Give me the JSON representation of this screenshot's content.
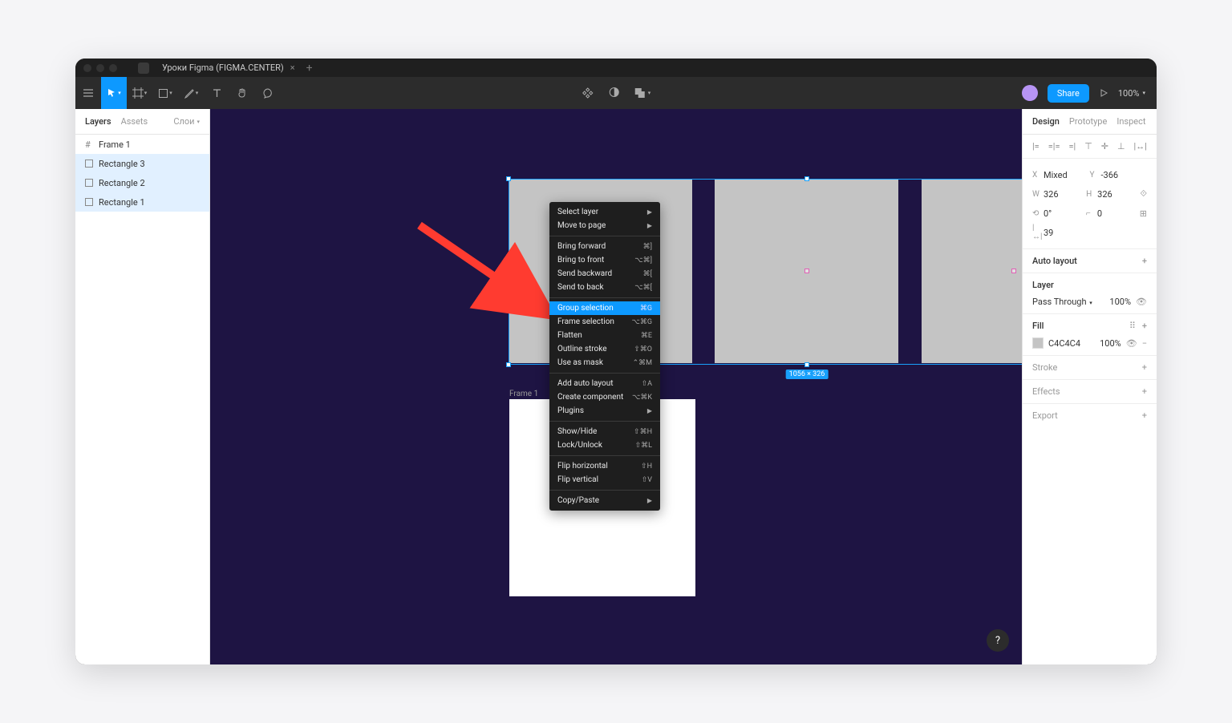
{
  "window": {
    "tab_title": "Уроки Figma (FIGMA.CENTER)"
  },
  "toolbar": {
    "share_label": "Share",
    "zoom_label": "100%"
  },
  "left_panel": {
    "tabs": {
      "layers": "Layers",
      "assets": "Assets",
      "pages_label": "Слои"
    },
    "layers": [
      {
        "name": "Frame 1",
        "selected": false,
        "type": "frame"
      },
      {
        "name": "Rectangle 3",
        "selected": true,
        "type": "rect"
      },
      {
        "name": "Rectangle 2",
        "selected": true,
        "type": "rect"
      },
      {
        "name": "Rectangle 1",
        "selected": true,
        "type": "rect"
      }
    ]
  },
  "canvas": {
    "dim_badge": "1056 × 326",
    "frame1_label": "Frame 1"
  },
  "context_menu": {
    "groups": [
      [
        {
          "label": "Select layer",
          "shortcut": "",
          "submenu": true
        },
        {
          "label": "Move to page",
          "shortcut": "",
          "submenu": true
        }
      ],
      [
        {
          "label": "Bring forward",
          "shortcut": "⌘]"
        },
        {
          "label": "Bring to front",
          "shortcut": "⌥⌘]"
        },
        {
          "label": "Send backward",
          "shortcut": "⌘["
        },
        {
          "label": "Send to back",
          "shortcut": "⌥⌘["
        }
      ],
      [
        {
          "label": "Group selection",
          "shortcut": "⌘G",
          "highlight": true
        },
        {
          "label": "Frame selection",
          "shortcut": "⌥⌘G"
        },
        {
          "label": "Flatten",
          "shortcut": "⌘E"
        },
        {
          "label": "Outline stroke",
          "shortcut": "⇧⌘O"
        },
        {
          "label": "Use as mask",
          "shortcut": "⌃⌘M"
        }
      ],
      [
        {
          "label": "Add auto layout",
          "shortcut": "⇧A"
        },
        {
          "label": "Create component",
          "shortcut": "⌥⌘K"
        },
        {
          "label": "Plugins",
          "shortcut": "",
          "submenu": true
        }
      ],
      [
        {
          "label": "Show/Hide",
          "shortcut": "⇧⌘H"
        },
        {
          "label": "Lock/Unlock",
          "shortcut": "⇧⌘L"
        }
      ],
      [
        {
          "label": "Flip horizontal",
          "shortcut": "⇧H"
        },
        {
          "label": "Flip vertical",
          "shortcut": "⇧V"
        }
      ],
      [
        {
          "label": "Copy/Paste",
          "shortcut": "",
          "submenu": true
        }
      ]
    ]
  },
  "right_panel": {
    "tabs": {
      "design": "Design",
      "prototype": "Prototype",
      "inspect": "Inspect"
    },
    "geom": {
      "x_label": "X",
      "x_value": "Mixed",
      "y_label": "Y",
      "y_value": "-366",
      "w_label": "W",
      "w_value": "326",
      "h_label": "H",
      "h_value": "326",
      "rot_label": "⟲",
      "rot_value": "0°",
      "radius_label": "⌐",
      "radius_value": "0",
      "gap_label": "|⟷|",
      "gap_value": "39"
    },
    "auto_layout": {
      "title": "Auto layout"
    },
    "layer": {
      "title": "Layer",
      "blend": "Pass Through",
      "opacity": "100%"
    },
    "fill": {
      "title": "Fill",
      "hex": "C4C4C4",
      "opacity": "100%"
    },
    "stroke": {
      "title": "Stroke"
    },
    "effects": {
      "title": "Effects"
    },
    "export": {
      "title": "Export"
    }
  },
  "help": {
    "label": "?"
  }
}
